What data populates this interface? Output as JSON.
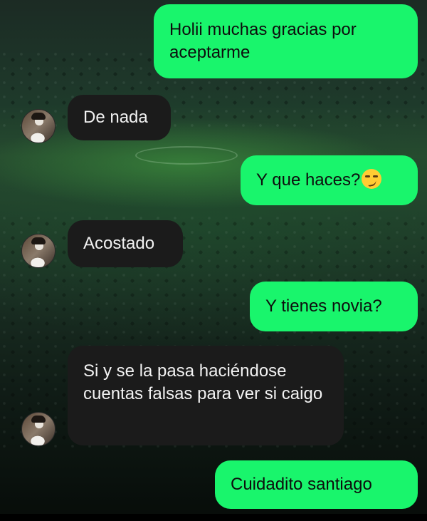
{
  "chat": {
    "messages": [
      {
        "side": "sent",
        "text": "Holii muchas gracias por aceptarme"
      },
      {
        "side": "received",
        "text": "De nada"
      },
      {
        "side": "sent",
        "text": "Y que haces?",
        "emoji": "smirking-face"
      },
      {
        "side": "received",
        "text": "Acostado"
      },
      {
        "side": "sent",
        "text": "Y tienes novia?"
      },
      {
        "side": "received",
        "text": "Si y se la pasa haciéndose cuentas falsas para ver si caigo"
      },
      {
        "side": "sent",
        "text": "Cuidadito santiago"
      }
    ]
  },
  "colors": {
    "sent_bubble": "#19f56c",
    "received_bubble": "#1b1b1b",
    "background": "#0b1510"
  }
}
